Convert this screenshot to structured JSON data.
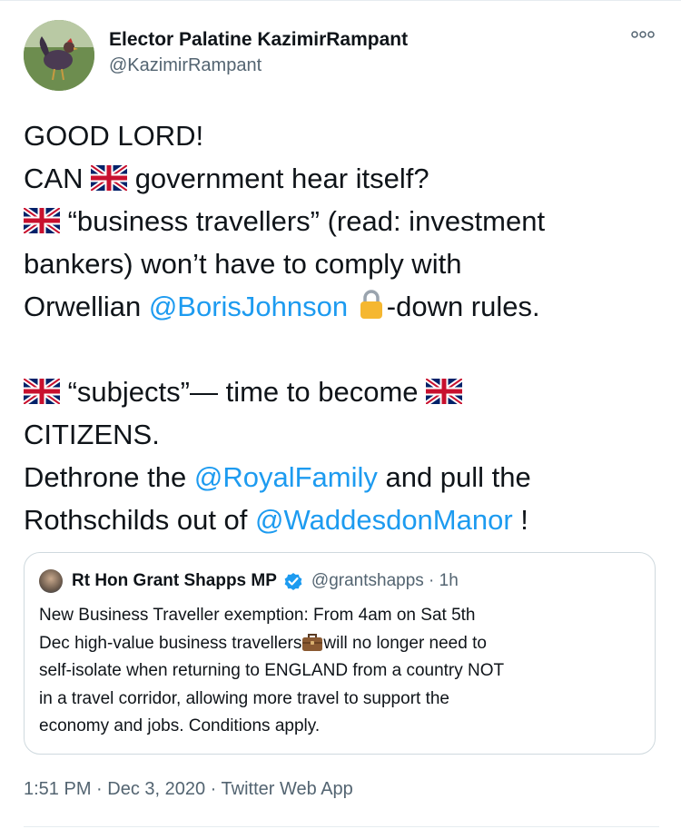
{
  "tweet": {
    "author": {
      "name": "Elector Palatine KazimirRampant",
      "handle": "@KazimirRampant",
      "avatar_icon": "rooster-avatar"
    },
    "more_icon": "more-dots-icon",
    "text": {
      "l1": "GOOD LORD!",
      "l2a": "CAN ",
      "l2b": " government hear itself?",
      "l3": " “business travellers” (read:  investment",
      "l4": "bankers) won’t have to comply with",
      "l5a": "Orwellian ",
      "l5_mention": "@BorisJohnson",
      "l5b": "-down rules.",
      "l6": " “subjects”— time to become ",
      "l7": "CITIZENS.",
      "l8a": "Dethrone the ",
      "l8_mention": "@RoyalFamily",
      "l8b": " and pull the",
      "l9a": "Rothschilds out of ",
      "l9_mention": "@WaddesdonManor",
      "l9b": " !"
    },
    "emoji": {
      "flag": "uk-flag-icon",
      "lock": "lock-icon",
      "briefcase": "briefcase-icon"
    },
    "quoted": {
      "name": "Rt Hon Grant Shapps MP",
      "handle_time": "@grantshapps · 1h",
      "verified_icon": "verified-badge-icon",
      "lines": {
        "q1": "New Business Traveller exemption: From 4am on Sat 5th",
        "q2a": "Dec high-value business travellers",
        "q2b": "will no longer need to",
        "q3": "self-isolate when returning to ENGLAND from a country NOT",
        "q4": "in a travel corridor, allowing more travel to support the",
        "q5": "economy and jobs. Conditions apply."
      }
    },
    "meta": {
      "time": "1:51 PM",
      "sep": " · ",
      "date": "Dec 3, 2020",
      "source": "Twitter Web App"
    },
    "colors": {
      "accent": "#1d9bf0",
      "text": "#0f1419",
      "secondary": "#536471",
      "border": "#cfd9de"
    }
  }
}
